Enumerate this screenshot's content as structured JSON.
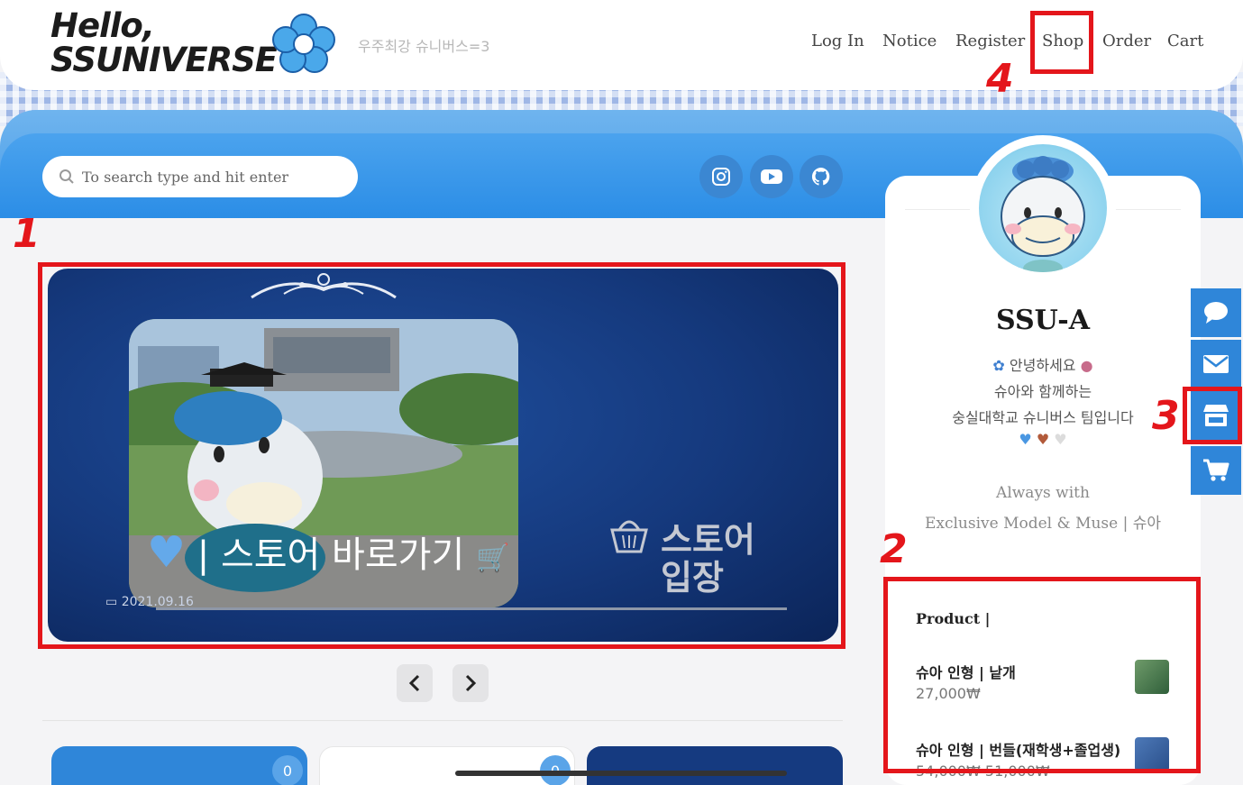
{
  "header": {
    "logo_line1": "Hello,",
    "logo_line2": "SSUNIVERSE",
    "tagline": "우주최강 슈니버스=3",
    "nav": [
      "Log In",
      "Notice",
      "Register",
      "Shop",
      "Order",
      "Cart"
    ]
  },
  "search": {
    "placeholder": "To search type and hit enter"
  },
  "social": [
    "instagram-icon",
    "youtube-icon",
    "github-icon"
  ],
  "slider": {
    "title": "| 스토어 바로가기",
    "date": "2021.09.16",
    "store_label_line1": "스토어",
    "store_label_line2": "입장"
  },
  "profile": {
    "name": "SSU-A",
    "bio_line1": "안녕하세요",
    "bio_line2": "슈아와 함께하는",
    "bio_line3": "숭실대학교 슈니버스 팀입니다",
    "motto_line1": "Always with",
    "motto_line2": "Exclusive Model & Muse | 슈아"
  },
  "products": {
    "title": "Product |",
    "items": [
      {
        "name": "슈아 인형 | 낱개",
        "price": "27,000₩"
      },
      {
        "name": "슈아 인형 | 번들(재학생+졸업생)",
        "price": "54,000₩ 51,000₩"
      }
    ]
  },
  "side_buttons": [
    "chat-icon",
    "mail-icon",
    "store-icon",
    "cart-icon"
  ],
  "post_counts": [
    "0",
    "0"
  ],
  "annotations": [
    "1",
    "2",
    "3",
    "4"
  ],
  "colors": {
    "accent_blue": "#2f86d9",
    "annotation_red": "#e4161b",
    "slider_navy": "#15397d"
  }
}
